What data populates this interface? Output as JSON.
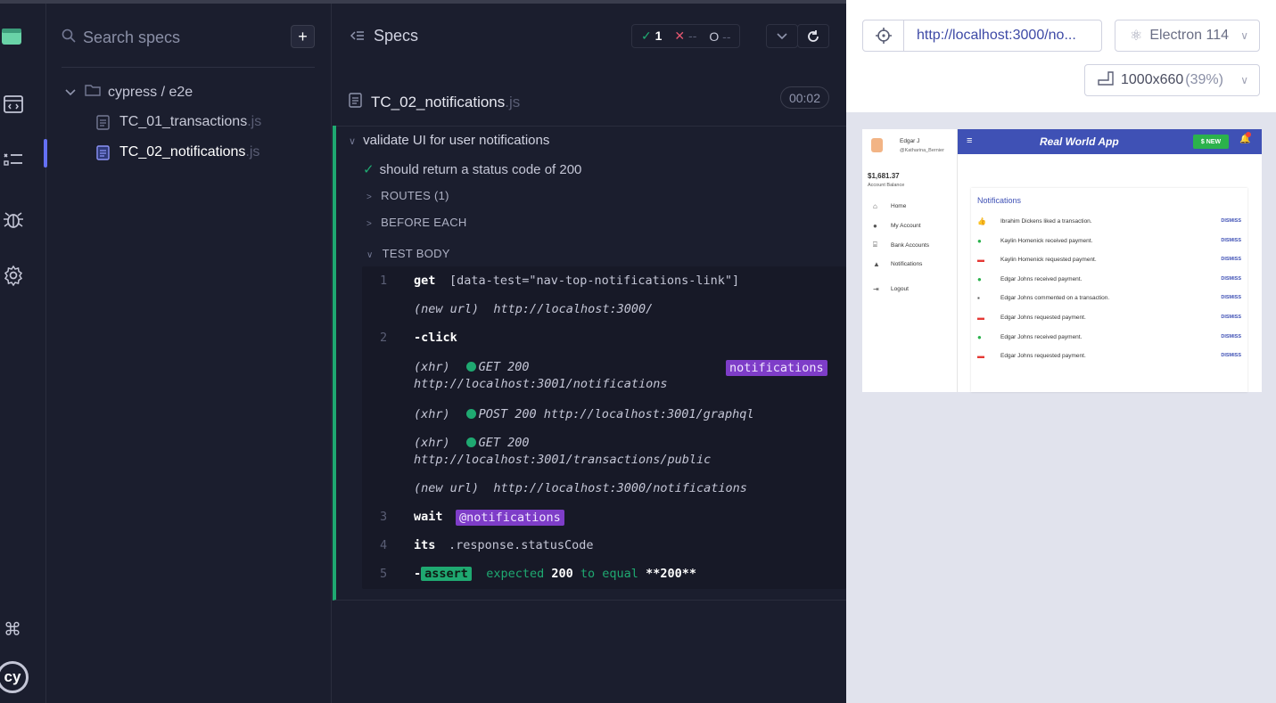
{
  "specs_panel": {
    "search_placeholder": "Search specs",
    "folder": "cypress / e2e",
    "files": [
      {
        "name": "TC_01_transactions",
        "ext": ".js"
      },
      {
        "name": "TC_02_notifications",
        "ext": ".js"
      }
    ]
  },
  "reporter": {
    "title": "Specs",
    "stats": {
      "passed": "1",
      "failed": "--",
      "pending": "--"
    },
    "spec_name": "TC_02_notifications",
    "spec_ext": ".js",
    "timer": "00:02",
    "suite": "validate UI for user notifications",
    "test": "should return a status code of 200",
    "hooks": [
      "ROUTES (1)",
      "BEFORE EACH",
      "TEST BODY"
    ],
    "commands": {
      "c1_num": "1",
      "c1_name": "get",
      "c1_msg": "[data-test=\"nav-top-notifications-link\"]",
      "new_url_label": "(new url)",
      "new_url_1": "http://localhost:3000/",
      "c2_num": "2",
      "c2_name": "-click",
      "xhr_label": "(xhr)",
      "xhr1_method": "GET 200",
      "xhr1_url": "http://localhost:3001/notifications",
      "xhr1_alias": "notifications",
      "xhr2": "POST 200 http://localhost:3001/graphql",
      "xhr3_method": "GET 200",
      "xhr3_url": "http://localhost:3001/transactions/public",
      "new_url_2": "http://localhost:3000/notifications",
      "c3_num": "3",
      "c3_name": "wait",
      "c3_alias": "@notifications",
      "c4_num": "4",
      "c4_name": "its",
      "c4_msg": ".response.statusCode",
      "c5_num": "5",
      "c5_dash": "-",
      "c5_badge": "assert",
      "c5_expected": "expected",
      "c5_val1": "200",
      "c5_to_equal": "to equal",
      "c5_val2": "**200**"
    }
  },
  "preview": {
    "url": "http://localhost:3000/no...",
    "browser": "Electron 114",
    "viewport": "1000x660",
    "zoom": "(39%)",
    "app": {
      "user_name": "Edgar J",
      "user_handle": "@Katharina_Bernier",
      "balance": "$1,681.37",
      "balance_label": "Account Balance",
      "nav": [
        "Home",
        "My Account",
        "Bank Accounts",
        "Notifications",
        "Logout"
      ],
      "title": "Real World App",
      "new_button": "$ NEW",
      "notifications_title": "Notifications",
      "dismiss": "DISMISS",
      "notifications": [
        "Ibrahim Dickens liked a transaction.",
        "Kaylin Homenick received payment.",
        "Kaylin Homenick requested payment.",
        "Edgar Johns received payment.",
        "Edgar Johns commented on a transaction.",
        "Edgar Johns requested payment.",
        "Edgar Johns received payment.",
        "Edgar Johns requested payment."
      ]
    }
  },
  "colors": {
    "accent": "#6470f3",
    "pass": "#1fa971",
    "fail": "#e45770",
    "alias": "#7e3dc8",
    "app_header": "#3f51b5"
  }
}
